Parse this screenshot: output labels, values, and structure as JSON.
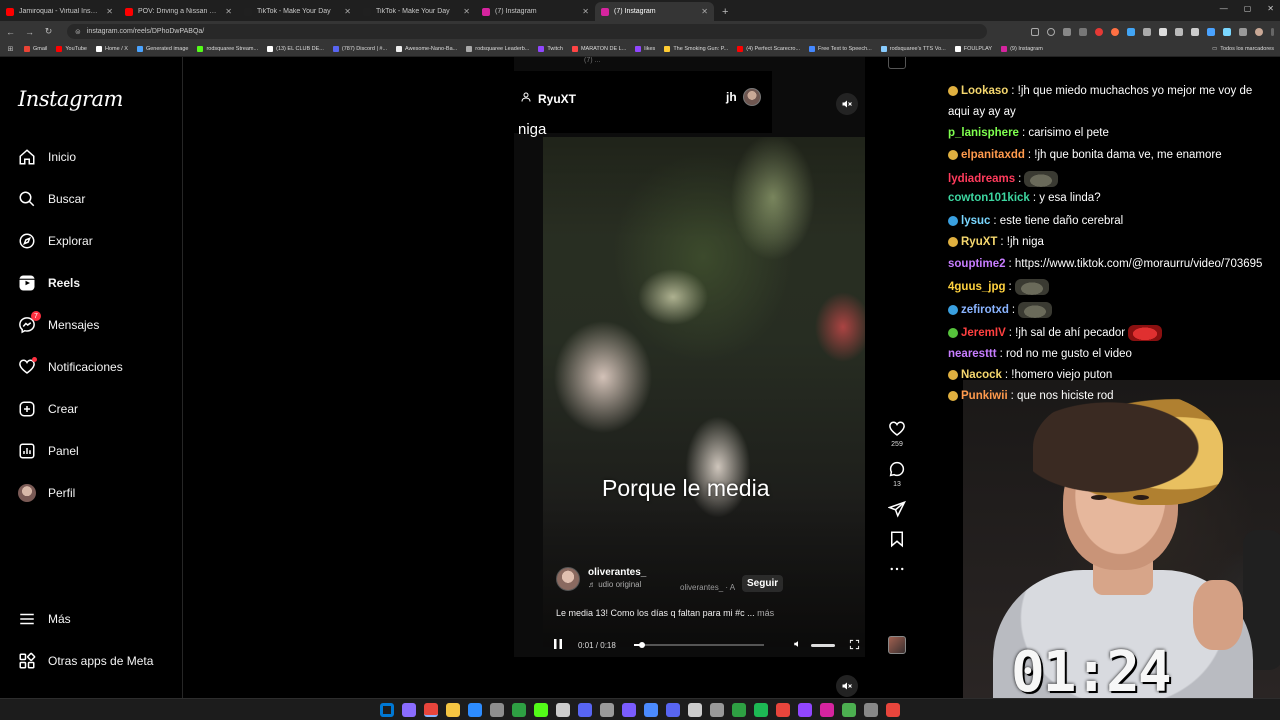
{
  "browser": {
    "tabs": [
      {
        "title": "Jamiroquai - Virtual Insanity (Official...",
        "color": "#ff0000"
      },
      {
        "title": "POV: Driving a Nissan R32 GT-R...",
        "color": "#ff0000"
      },
      {
        "title": "TikTok - Make Your Day",
        "color": "#202020"
      },
      {
        "title": "TikTok - Make Your Day",
        "color": "#202020"
      },
      {
        "title": "(7) Instagram",
        "color": "#d6249f"
      },
      {
        "title": "(7) Instagram",
        "color": "#d6249f"
      }
    ],
    "new_tab": "+",
    "url": "instagram.com/reels/DPhoDwPABQa/",
    "window_controls": [
      "—",
      "▢",
      "✕"
    ],
    "bookmarks": [
      {
        "label": "Gmail",
        "color": "#ea4335"
      },
      {
        "label": "YouTube",
        "color": "#ff0000"
      },
      {
        "label": "Home / X",
        "color": "#ffffff"
      },
      {
        "label": "Generated image",
        "color": "#4aa3ff"
      },
      {
        "label": "rodsquaree Stream...",
        "color": "#53fc18"
      },
      {
        "label": "(13) EL CLUB DE...",
        "color": "#ffffff"
      },
      {
        "label": "(787) Discord | #...",
        "color": "#5865f2"
      },
      {
        "label": "Awesome-Nano-Ba...",
        "color": "#eeeeee"
      },
      {
        "label": "rodsquaree Leaderb...",
        "color": "#aaaaaa"
      },
      {
        "label": "Twitch",
        "color": "#9146ff"
      },
      {
        "label": "MARATON DE L...",
        "color": "#ff4444"
      },
      {
        "label": "likes",
        "color": "#9146ff"
      },
      {
        "label": "The Smoking Gun: P...",
        "color": "#ffcc33"
      },
      {
        "label": "(4) Perfect Scarecro...",
        "color": "#ff0000"
      },
      {
        "label": "Free Text to Speech...",
        "color": "#4488ff"
      },
      {
        "label": "rodsquaree's TTS Vo...",
        "color": "#88ccff"
      },
      {
        "label": "FOULPLAY",
        "color": "#ffffff"
      },
      {
        "label": "(9) Instagram",
        "color": "#d6249f"
      }
    ],
    "bookmarks_right": "Todos los marcadores"
  },
  "instagram": {
    "logo": "Instagram",
    "nav": [
      {
        "label": "Inicio",
        "icon": "home-icon"
      },
      {
        "label": "Buscar",
        "icon": "search-icon"
      },
      {
        "label": "Explorar",
        "icon": "explore-icon"
      },
      {
        "label": "Reels",
        "icon": "reels-icon"
      },
      {
        "label": "Mensajes",
        "icon": "messenger-icon",
        "badge": "7"
      },
      {
        "label": "Notificaciones",
        "icon": "heart-icon"
      },
      {
        "label": "Crear",
        "icon": "plus-icon"
      },
      {
        "label": "Panel",
        "icon": "chart-icon"
      },
      {
        "label": "Perfil",
        "icon": "avatar"
      }
    ],
    "more": "Más",
    "meta_apps": "Otras apps de Meta"
  },
  "reel": {
    "shared_by": "RyuXT",
    "shared_right": "jh",
    "shared_message": "niga",
    "top_fragment": "(7) ...",
    "caption_overlay": "Porque le media",
    "creator": "oliverantes_",
    "audio": "udio original",
    "audio_tag": "oliverantes_ · A",
    "follow": "Seguir",
    "description": "Le media 13! Como los días q faltan para mi #c ...",
    "more": "más",
    "time": "0:01 / 0:18",
    "progress": 0.06,
    "likes": "259",
    "comments": "13"
  },
  "chat": [
    {
      "user": "Lookaso",
      "text": ": !jh que miedo muchachos yo mejor me voy de",
      "color": "#f5d76e",
      "badge": "#e0b040"
    },
    {
      "user": "",
      "text": "aqui ay ay ay",
      "color": "#ffffff",
      "badge": ""
    },
    {
      "user": "p_lanisphere",
      "text": ": carisimo el pete",
      "color": "#7fff4f",
      "badge": ""
    },
    {
      "user": "elpanitaxdd",
      "text": ": !jh que bonita dama ve, me enamore",
      "color": "#ff9a4d",
      "badge": "#e0b040"
    },
    {
      "user": "lydiadreams",
      "text": ":",
      "color": "#ff3b5c",
      "badge": "",
      "emote": "grey"
    },
    {
      "user": "cowton101kick",
      "text": ": y esa linda?",
      "color": "#3dd6a0",
      "badge": ""
    },
    {
      "user": "lysuc",
      "text": ": este tiene daño cerebral",
      "color": "#7ad7ff",
      "badge": "#3aa0e0"
    },
    {
      "user": "RyuXT",
      "text": ": !jh niga",
      "color": "#f5d76e",
      "badge": "#e0b040"
    },
    {
      "user": "souptime2",
      "text": ": https://www.tiktok.com/@moraurru/video/703695",
      "color": "#c77dff",
      "badge": ""
    },
    {
      "user": "4guus_jpg",
      "text": ":",
      "color": "#ffd23f",
      "badge": "",
      "emote": "grey"
    },
    {
      "user": "zefirotxd",
      "text": ":",
      "color": "#8ab4ff",
      "badge": "#3aa0e0",
      "emote": "grey"
    },
    {
      "user": "JeremIV",
      "text": ": !jh sal de ahí pecador",
      "color": "#ff4040",
      "badge": "#56c43c",
      "emote": "red"
    },
    {
      "user": "nearesttt",
      "text": ": rod no me gusto el video",
      "color": "#c77dff",
      "badge": ""
    },
    {
      "user": "Nacock",
      "text": ": !homero viejo puton",
      "color": "#f5d76e",
      "badge": "#e0b040"
    },
    {
      "user": "Punkiwii",
      "text": ": que nos hiciste rod",
      "color": "#ff9a4d",
      "badge": "#e0b040"
    }
  ],
  "webcam": {
    "overlay_text": "01:24"
  },
  "taskbar": {
    "icons": [
      "#0078d4",
      "#8a6cff",
      "#e8453c",
      "#f5c542",
      "#2d8cff",
      "#8e8e8e",
      "#2ea043",
      "#53fc18",
      "#cccccc",
      "#5865f2",
      "#9a9a9a",
      "#7a5cff",
      "#4b8bff",
      "#5865f2",
      "#cccccc",
      "#999999",
      "#2ea043",
      "#1db954",
      "#e8453c",
      "#9146ff",
      "#d6249f",
      "#4caf50",
      "#888888",
      "#e8453c"
    ]
  }
}
